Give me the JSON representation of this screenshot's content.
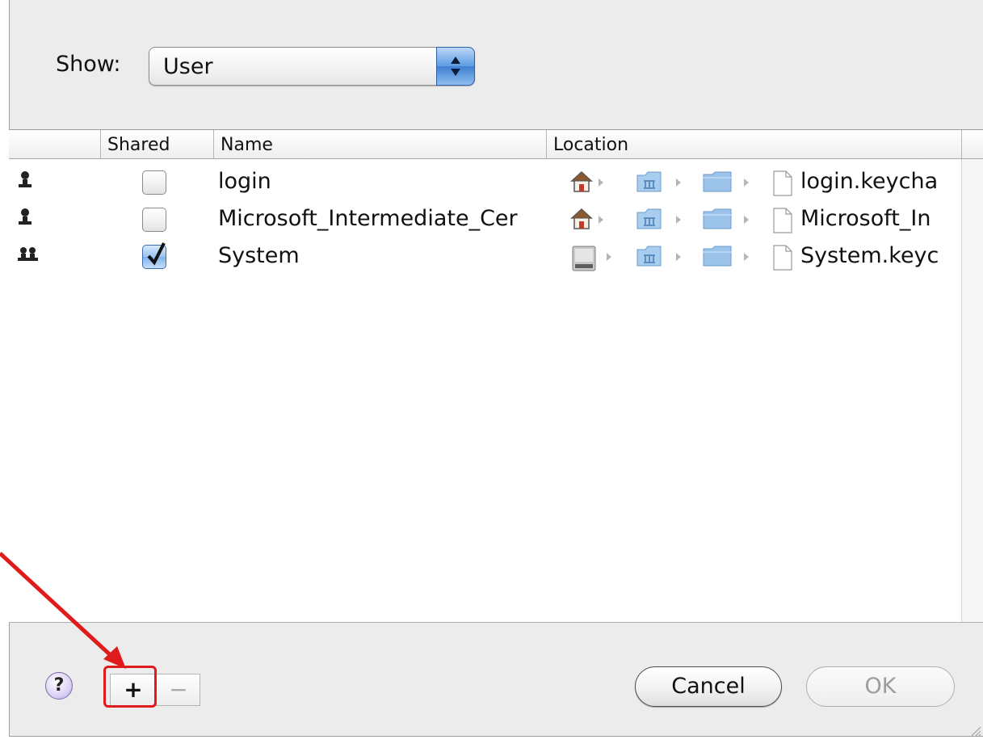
{
  "toolbar": {
    "show_label": "Show:",
    "show_value": "User"
  },
  "table": {
    "columns": [
      "",
      "Shared",
      "Name",
      "Location",
      ""
    ],
    "rows": [
      {
        "owner_icon": "single-user-icon",
        "shared": false,
        "name": "login",
        "file": "login.keycha",
        "path_icons": [
          "home-icon",
          "library-folder-icon",
          "folder-icon",
          "document-icon"
        ]
      },
      {
        "owner_icon": "single-user-icon",
        "shared": false,
        "name": "Microsoft_Intermediate_Cer",
        "file": "Microsoft_In",
        "path_icons": [
          "home-icon",
          "library-folder-icon",
          "folder-icon",
          "document-icon"
        ]
      },
      {
        "owner_icon": "group-users-icon",
        "shared": true,
        "name": "System",
        "file": "System.keyc",
        "path_icons": [
          "hard-disk-icon",
          "library-folder-icon",
          "folder-icon",
          "document-icon"
        ]
      }
    ]
  },
  "footer": {
    "help_label": "?",
    "add_label": "+",
    "remove_label": "−",
    "cancel_label": "Cancel",
    "ok_label": "OK"
  },
  "annotation": {
    "highlight_color": "#e01b1b"
  }
}
